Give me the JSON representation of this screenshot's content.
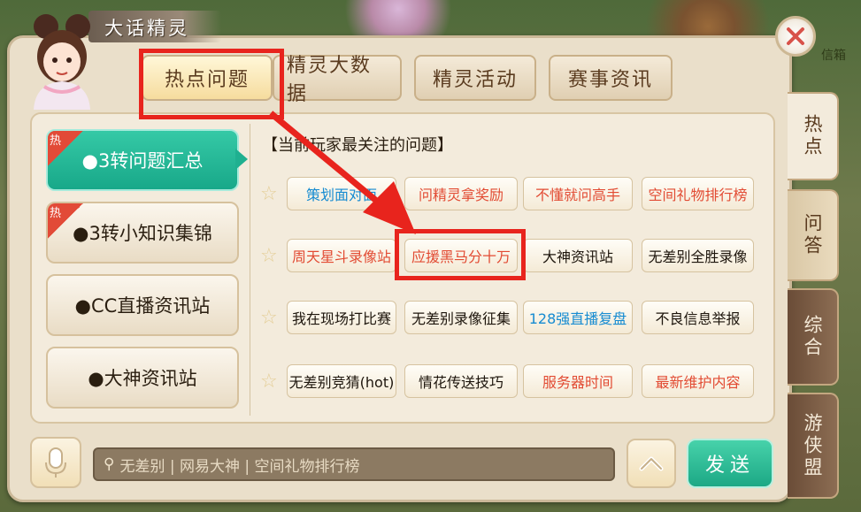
{
  "window": {
    "title": "大话精灵",
    "close_icon": "close-icon",
    "mailbox_label": "信箱"
  },
  "tabs": [
    {
      "label": "热点问题",
      "active": true
    },
    {
      "label": "精灵大数据",
      "active": false
    },
    {
      "label": "精灵活动",
      "active": false
    },
    {
      "label": "赛事资讯",
      "active": false
    }
  ],
  "categories": [
    {
      "label": "●3转问题汇总",
      "hot_badge": "热",
      "active": true
    },
    {
      "label": "●3转小知识集锦",
      "hot_badge": "热",
      "active": false
    },
    {
      "label": "●CC直播资讯站",
      "active": false
    },
    {
      "label": "●大神资讯站",
      "active": false
    }
  ],
  "main": {
    "heading": "【当前玩家最关注的问题】",
    "rows": [
      [
        "策划面对面",
        "问精灵拿奖励",
        "不懂就问高手",
        "空间礼物排行榜"
      ],
      [
        "周天星斗录像站",
        "应援黑马分十万",
        "大神资讯站",
        "无差别全胜录像"
      ],
      [
        "我在现场打比赛",
        "无差别录像征集",
        "128强直播复盘",
        "不良信息举报"
      ],
      [
        "无差别竞猜(hot)",
        "情花传送技巧",
        "服务器时间",
        "最新维护内容"
      ]
    ],
    "row_colors": [
      [
        "blue",
        "red",
        "red",
        "red"
      ],
      [
        "red",
        "red",
        "black",
        "black"
      ],
      [
        "black",
        "black",
        "blue",
        "black"
      ],
      [
        "black",
        "black",
        "red",
        "red"
      ]
    ]
  },
  "side_tabs": [
    {
      "label": "热点",
      "state": "active"
    },
    {
      "label": "问答",
      "state": "normal"
    },
    {
      "label": "综合",
      "state": "dark"
    },
    {
      "label": "游侠盟",
      "state": "dark"
    }
  ],
  "bottom": {
    "search_placeholder": "无差别 | 网易大神 | 空间礼物排行榜",
    "send_label": "发送",
    "mic_icon": "microphone-icon",
    "up_icon": "chevron-up-icon",
    "search_icon": "search-icon"
  },
  "colors": {
    "accent_green": "#1fb090",
    "highlight_red": "#e8241d",
    "hot_red": "#e24a37"
  }
}
